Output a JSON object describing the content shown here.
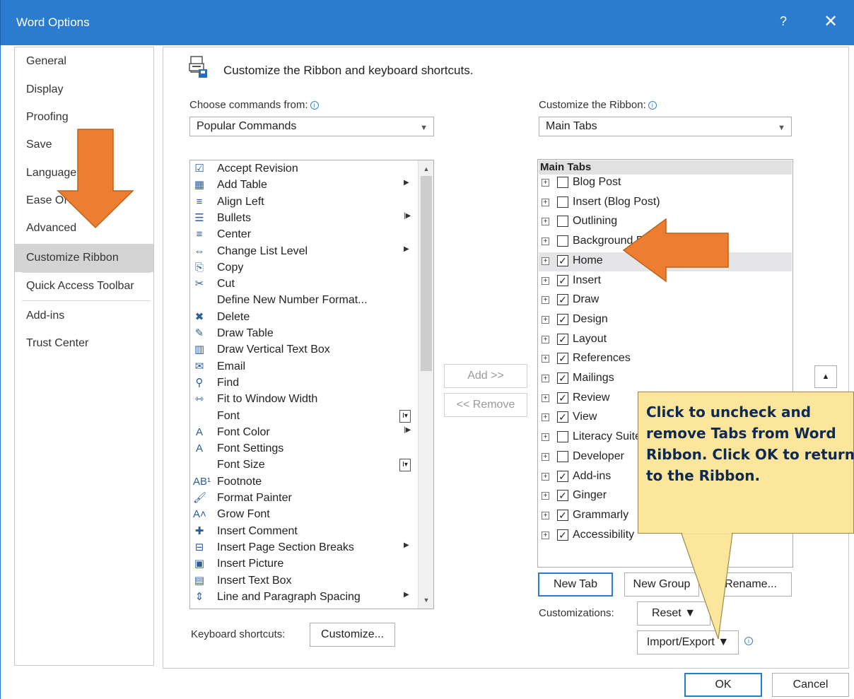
{
  "window": {
    "title": "Word Options",
    "help": "?",
    "close": "✕"
  },
  "nav": {
    "items": [
      {
        "label": "General"
      },
      {
        "label": "Display"
      },
      {
        "label": "Proofing"
      },
      {
        "label": "Save"
      },
      {
        "label": "Language"
      },
      {
        "label": "Ease Of Access"
      },
      {
        "label": "Advanced"
      },
      {
        "label": "Customize Ribbon",
        "selected": true
      },
      {
        "label": "Quick Access Toolbar"
      },
      {
        "label": "Add-ins"
      },
      {
        "label": "Trust Center"
      }
    ]
  },
  "header": {
    "title": "Customize the Ribbon and keyboard shortcuts."
  },
  "left": {
    "choose_label": "Choose commands from:",
    "choose_value": "Popular Commands",
    "commands": [
      {
        "label": "Accept Revision",
        "icon": "accept-revision-icon",
        "glyph": "☑"
      },
      {
        "label": "Add Table",
        "icon": "table-icon",
        "glyph": "▦",
        "sub": "▶"
      },
      {
        "label": "Align Left",
        "icon": "align-left-icon",
        "glyph": "≡"
      },
      {
        "label": "Bullets",
        "icon": "bullets-icon",
        "glyph": "☰",
        "sub": "|▶"
      },
      {
        "label": "Center",
        "icon": "center-icon",
        "glyph": "≡"
      },
      {
        "label": "Change List Level",
        "icon": "list-level-icon",
        "glyph": "⇔",
        "sub": "▶"
      },
      {
        "label": "Copy",
        "icon": "copy-icon",
        "glyph": "⎘"
      },
      {
        "label": "Cut",
        "icon": "scissors-icon",
        "glyph": "✂"
      },
      {
        "label": "Define New Number Format...",
        "icon": "",
        "glyph": ""
      },
      {
        "label": "Delete",
        "icon": "delete-comment-icon",
        "glyph": "✖"
      },
      {
        "label": "Draw Table",
        "icon": "draw-table-icon",
        "glyph": "✎"
      },
      {
        "label": "Draw Vertical Text Box",
        "icon": "vertical-textbox-icon",
        "glyph": "▥"
      },
      {
        "label": "Email",
        "icon": "email-icon",
        "glyph": "✉"
      },
      {
        "label": "Find",
        "icon": "find-icon",
        "glyph": "⚲"
      },
      {
        "label": "Fit to Window Width",
        "icon": "fit-width-icon",
        "glyph": "⇿"
      },
      {
        "label": "Font",
        "icon": "",
        "glyph": "",
        "box": "I▾"
      },
      {
        "label": "Font Color",
        "icon": "font-color-icon",
        "glyph": "A",
        "sub": "|▶"
      },
      {
        "label": "Font Settings",
        "icon": "font-settings-icon",
        "glyph": "A"
      },
      {
        "label": "Font Size",
        "icon": "",
        "glyph": "",
        "box": "I▾"
      },
      {
        "label": "Footnote",
        "icon": "footnote-icon",
        "glyph": "AB¹"
      },
      {
        "label": "Format Painter",
        "icon": "format-painter-icon",
        "glyph": "🖌"
      },
      {
        "label": "Grow Font",
        "icon": "grow-font-icon",
        "glyph": "A˄"
      },
      {
        "label": "Insert Comment",
        "icon": "insert-comment-icon",
        "glyph": "✚"
      },
      {
        "label": "Insert Page  Section Breaks",
        "icon": "page-break-icon",
        "glyph": "⊟",
        "sub": "▶"
      },
      {
        "label": "Insert Picture",
        "icon": "picture-icon",
        "glyph": "▣"
      },
      {
        "label": "Insert Text Box",
        "icon": "textbox-icon",
        "glyph": "▤"
      },
      {
        "label": "Line and Paragraph Spacing",
        "icon": "line-spacing-icon",
        "glyph": "⇕",
        "sub": "▶"
      }
    ],
    "keyboard_label": "Keyboard shortcuts:",
    "customize_button": "Customize..."
  },
  "middle": {
    "add_button": "Add >>",
    "remove_button": "<< Remove"
  },
  "right": {
    "customize_label": "Customize the Ribbon:",
    "customize_value": "Main Tabs",
    "list_header": "Main Tabs",
    "tabs": [
      {
        "label": "Blog Post",
        "checked": false
      },
      {
        "label": "Insert (Blog Post)",
        "checked": false
      },
      {
        "label": "Outlining",
        "checked": false
      },
      {
        "label": "Background Removal",
        "checked": false
      },
      {
        "label": "Home",
        "checked": true,
        "highlighted": true
      },
      {
        "label": "Insert",
        "checked": true
      },
      {
        "label": "Draw",
        "checked": true
      },
      {
        "label": "Design",
        "checked": true
      },
      {
        "label": "Layout",
        "checked": true
      },
      {
        "label": "References",
        "checked": true
      },
      {
        "label": "Mailings",
        "checked": true
      },
      {
        "label": "Review",
        "checked": true
      },
      {
        "label": "View",
        "checked": true
      },
      {
        "label": "Literacy Suite",
        "checked": false
      },
      {
        "label": "Developer",
        "checked": false
      },
      {
        "label": "Add-ins",
        "checked": true
      },
      {
        "label": "Ginger",
        "checked": true
      },
      {
        "label": "Grammarly",
        "checked": true
      },
      {
        "label": "Accessibility",
        "checked": true
      }
    ],
    "new_tab_button": "New Tab",
    "new_group_button": "New Group",
    "rename_button": "Rename...",
    "customizations_label": "Customizations:",
    "reset_button": "Reset ▼",
    "import_export_button": "Import/Export ▼"
  },
  "footer": {
    "ok_button": "OK",
    "cancel_button": "Cancel"
  },
  "callout": {
    "text": "Click to uncheck and remove Tabs from Word Ribbon. Click OK to return to the Ribbon."
  },
  "colors": {
    "titlebar": "#2b7bd0",
    "arrow": "#ed7d31",
    "callout": "#fce69c",
    "callout_text": "#0e2a52"
  }
}
